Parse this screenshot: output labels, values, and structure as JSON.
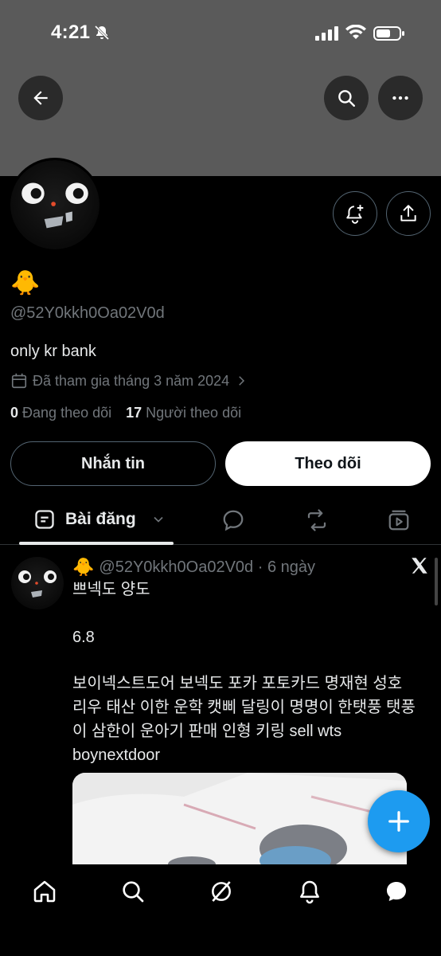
{
  "status_bar": {
    "time": "4:21"
  },
  "profile": {
    "display_name_emoji": "🐥",
    "handle": "@52Y0kkh0Oa02V0d",
    "bio": "only kr bank",
    "joined": "Đã tham gia tháng 3 năm 2024",
    "following_count": "0",
    "following_label": "Đang theo dõi",
    "followers_count": "17",
    "followers_label": "Người theo dõi"
  },
  "buttons": {
    "message": "Nhắn tin",
    "follow": "Theo dõi"
  },
  "tabs": {
    "posts_label": "Bài đăng"
  },
  "post": {
    "author_emoji": "🐥",
    "handle_time": "@52Y0kkh0Oa02V0d · 6 ngày",
    "line1": "쁘넥도 양도",
    "line2": "6.8",
    "body_lines": [
      "보이넥스트도어 보넥도 포카 포토카드 명재현 성호",
      "리우 태산 이한 운학 캣삐 달링이 명명이 한탯풍 탯풍",
      "이 삼한이 운아기 판매 인형 키링 sell wts",
      "boynextdoor"
    ]
  },
  "colors": {
    "accent": "#1d9bf0",
    "banner": "#5a5a5a",
    "muted": "#71767b"
  }
}
